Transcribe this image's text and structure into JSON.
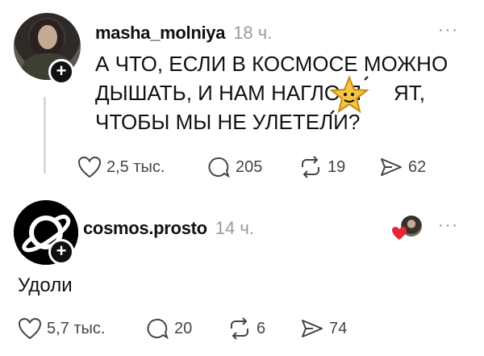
{
  "post": {
    "username": "masha_molniya",
    "time": "18 ч.",
    "text_line1": "А ЧТО, ЕСЛИ В КОСМОСЕ МОЖНО",
    "text_line2": "ДЫШАТЬ, И НАМ НАГЛО П",
    "text_line2_end": "ЯТ,",
    "text_line3": "ЧТОБЫ МЫ НЕ УЛЕТЕЛИ?",
    "likes": "2,5 тыс.",
    "replies": "205",
    "reposts": "19",
    "shares": "62",
    "more": "···"
  },
  "reply": {
    "username": "cosmos.prosto",
    "time": "14 ч.",
    "text": "Удоли",
    "likes": "5,7 тыс.",
    "replies": "20",
    "reposts": "6",
    "shares": "74",
    "more": "···"
  },
  "colors": {
    "heart": "#e8263a",
    "muted": "#9a9a9a",
    "text": "#111111",
    "sticker": "#f5c542"
  },
  "icons": [
    "heart-icon",
    "comment-icon",
    "repost-icon",
    "share-icon",
    "plus-icon",
    "more-icon",
    "star-sticker-icon"
  ]
}
